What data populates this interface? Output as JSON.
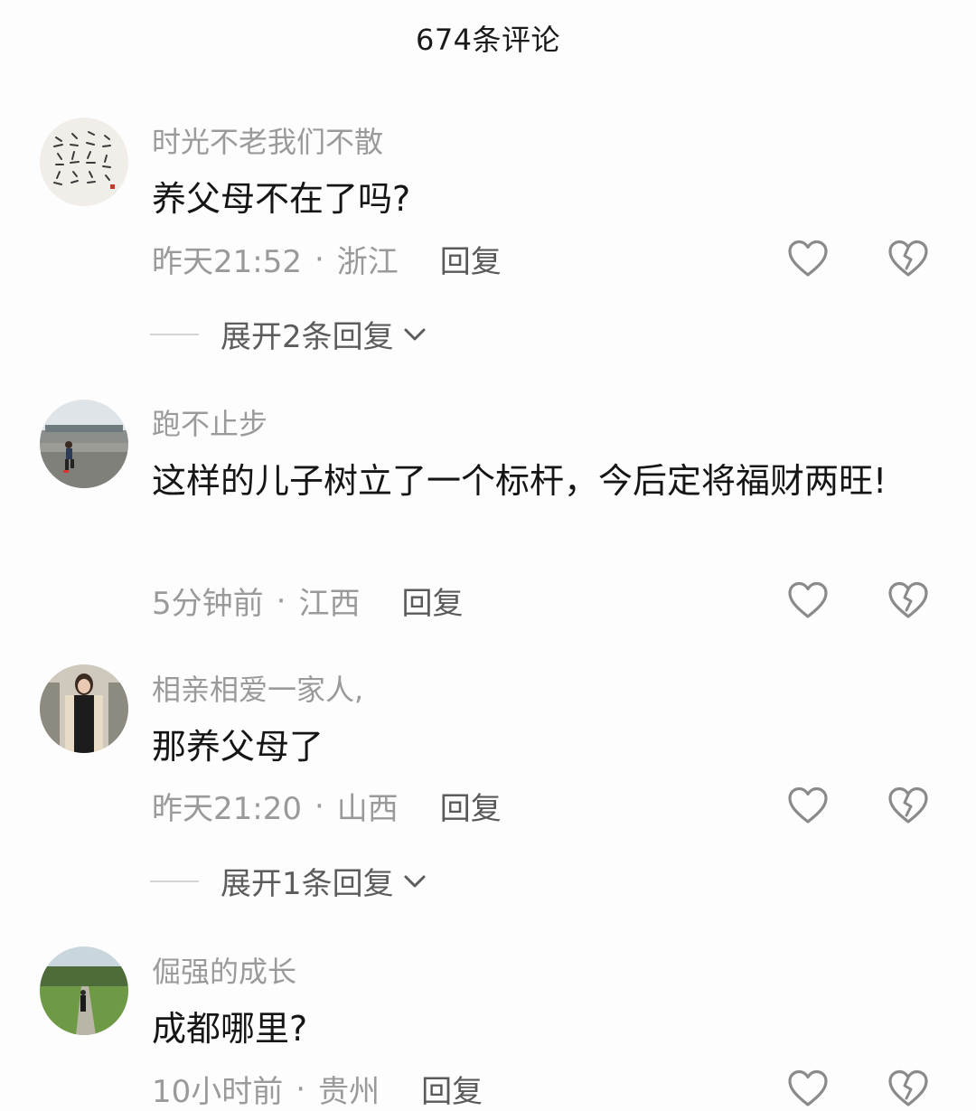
{
  "header": {
    "title": "674条评论"
  },
  "comments": [
    {
      "username": "时光不老我们不散",
      "text": "养父母不在了吗?",
      "time": "昨天21:52",
      "location": "浙江",
      "reply_label": "回复",
      "expand_label": "展开2条回复"
    },
    {
      "username": "跑不止步",
      "text": "这样的儿子树立了一个标杆，今后定将福财两旺!",
      "time": "5分钟前",
      "location": "江西",
      "reply_label": "回复"
    },
    {
      "username": "相亲相爱一家人,",
      "text": "那养父母了",
      "time": "昨天21:20",
      "location": "山西",
      "reply_label": "回复",
      "expand_label": "展开1条回复"
    },
    {
      "username": "倔强的成长",
      "text": "成都哪里?",
      "time": "10小时前",
      "location": "贵州",
      "reply_label": "回复"
    }
  ],
  "separator": "·",
  "icons": {
    "like": "heart-outline-icon",
    "dislike": "broken-heart-icon",
    "expand": "chevron-down-icon"
  },
  "colors": {
    "background": "#fdfdfd",
    "username": "#9a9a9a",
    "text": "#151515",
    "reply": "#5a5a5a",
    "icon": "#8a8a8a"
  }
}
